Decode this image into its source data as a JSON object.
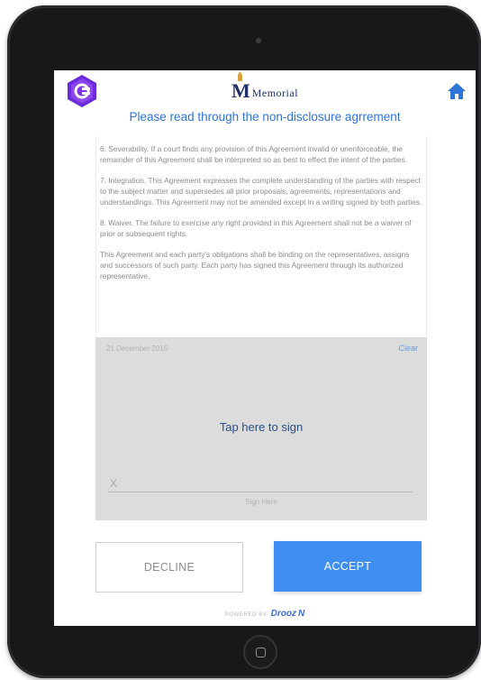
{
  "header": {
    "brand_initial": "M",
    "brand_name": "Memorial",
    "instruction": "Please read through the non-disclosure agrrement"
  },
  "icons": {
    "app_logo": "cube-logo-icon",
    "home": "home-icon",
    "brand_flame": "flame-icon"
  },
  "document": {
    "paragraphs": [
      "6.  Severability. If a court finds any provision of this Agreement invalid or unenforceable, the remainder of this Agreement shall be interpreted so as best to effect the intent of the parties.",
      "7.  Integration. This Agreement expresses the complete understanding of the parties with respect to the subject matter and supersedes all prior proposals, agreements, representations and understandings. This Agreement may not be amended except in a writing signed by both parties.",
      "8.  Waiver. The failure to exercise any right provided in this Agreement shall not be a waiver of prior or subsequent rights.",
      "This Agreement and each party's obligations shall be binding on the representatives, assigns and successors of such party. Each party has signed this Agreement through its authorized representative."
    ]
  },
  "signature": {
    "date": "21 December 2015",
    "clear_label": "Clear",
    "prompt": "Tap here to sign",
    "x_mark": "X",
    "line_label": "Sign Here"
  },
  "actions": {
    "decline_label": "DECLINE",
    "accept_label": "ACCEPT"
  },
  "footer": {
    "powered_by": "POWERED BY",
    "powered_brand": "Drooz N"
  },
  "colors": {
    "accent": "#3f8ef2",
    "instruction_text": "#2f74d8",
    "brand_navy": "#1f2e66",
    "sign_area_bg": "#dcdcdc",
    "device_frame": "#17181a"
  }
}
